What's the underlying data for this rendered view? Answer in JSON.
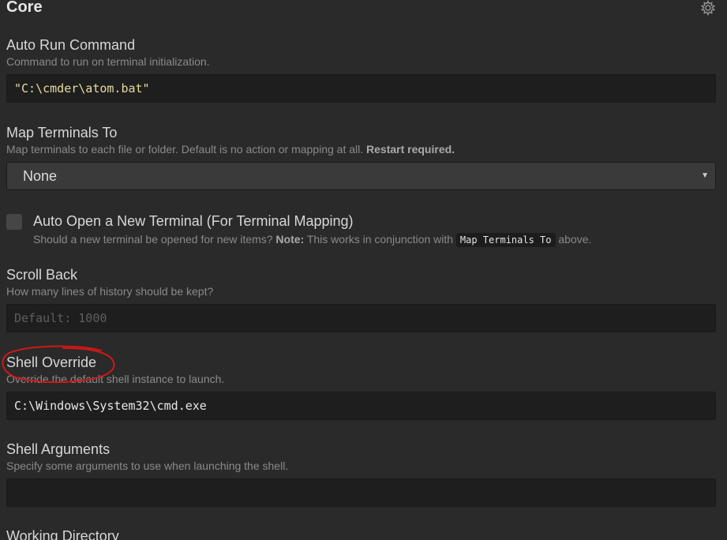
{
  "section": {
    "title": "Core",
    "icon": "settings-gear-icon"
  },
  "settings": {
    "auto_run_command": {
      "title": "Auto Run Command",
      "description": "Command to run on terminal initialization.",
      "value": "\"C:\\cmder\\atom.bat\""
    },
    "map_terminals_to": {
      "title": "Map Terminals To",
      "description": "Map terminals to each file or folder. Default is no action or mapping at all.",
      "description_bold": "Restart required.",
      "selected": "None",
      "caret_icon": "chevron-down-icon"
    },
    "auto_open_new_terminal": {
      "title": "Auto Open a New Terminal (For Terminal Mapping)",
      "description_pre": "Should a new terminal be opened for new items?",
      "note_label": "Note:",
      "description_mid": "This works in conjunction with",
      "code_ref": "Map Terminals To",
      "description_post": "above.",
      "checked": false
    },
    "scroll_back": {
      "title": "Scroll Back",
      "description": "How many lines of history should be kept?",
      "placeholder": "Default: 1000",
      "value": ""
    },
    "shell_override": {
      "title": "Shell Override",
      "description": "Override the default shell instance to launch.",
      "value": "C:\\Windows\\System32\\cmd.exe"
    },
    "shell_arguments": {
      "title": "Shell Arguments",
      "description": "Specify some arguments to use when launching the shell.",
      "value": ""
    },
    "working_directory": {
      "title": "Working Directory"
    }
  },
  "annotation": {
    "type": "hand-drawn-ellipse",
    "color": "#d01818",
    "target": "Shell Override"
  }
}
